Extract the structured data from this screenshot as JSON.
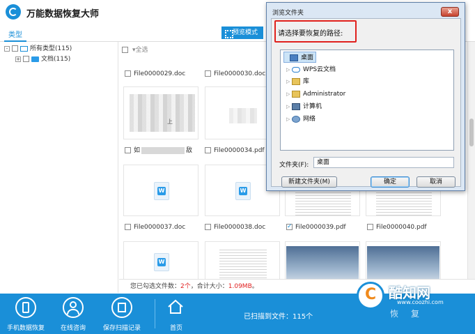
{
  "app": {
    "title": "万能数据恢复大师"
  },
  "tabs": {
    "type_label": "类型",
    "preview_label": "预览模式"
  },
  "tree": [
    {
      "expander": "-",
      "label": "所有类型(115)"
    },
    {
      "expander": "+",
      "label": "文档(115)"
    }
  ],
  "grid": {
    "select_all": "全选",
    "files": [
      {
        "name": "File0000029.doc",
        "checked": false
      },
      {
        "name": "File0000030.doc",
        "checked": false
      },
      {
        "name": "如",
        "checked": false
      },
      {
        "name": "File0000034.pdf",
        "checked": false
      },
      {
        "name": "File0000037.doc",
        "checked": false
      },
      {
        "name": "File0000038.doc",
        "checked": false
      },
      {
        "name": "File0000039.pdf",
        "checked": true
      },
      {
        "name": "File0000040.pdf",
        "checked": false
      }
    ],
    "partial_texts": [
      "敌",
      "上"
    ]
  },
  "status": {
    "prefix": "您已勾选文件数：",
    "count": "2个",
    "mid": "，合计大小：",
    "size": "1.09MB",
    "suffix": "。"
  },
  "bottom": {
    "phone_recovery": "手机数据恢复",
    "online_consult": "在线咨询",
    "save_scan": "保存扫描记录",
    "home": "首页",
    "scanned_text": "已扫描到文件：115个",
    "recover_label": "恢复"
  },
  "watermark": {
    "title": "酷知网",
    "url": "www.coozhi.com"
  },
  "dialog": {
    "title": "浏览文件夹",
    "close": "x",
    "prompt": "请选择要恢复的路径:",
    "folders": [
      {
        "label": "桌面",
        "arrow": "",
        "icon": "desktop-icon",
        "selected": true
      },
      {
        "label": "WPS云文档",
        "arrow": "▷",
        "icon": "cloud-icon",
        "selected": false
      },
      {
        "label": "库",
        "arrow": "▷",
        "icon": "library-icon",
        "selected": false
      },
      {
        "label": "Administrator",
        "arrow": "▷",
        "icon": "user-folder-icon",
        "selected": false
      },
      {
        "label": "计算机",
        "arrow": "▷",
        "icon": "computer-icon",
        "selected": false
      },
      {
        "label": "网络",
        "arrow": "▷",
        "icon": "network-icon",
        "selected": false
      }
    ],
    "folder_label": "文件夹(F):",
    "folder_value": "桌面",
    "new_folder": "新建文件夹(M)",
    "ok": "确定",
    "cancel": "取消"
  }
}
